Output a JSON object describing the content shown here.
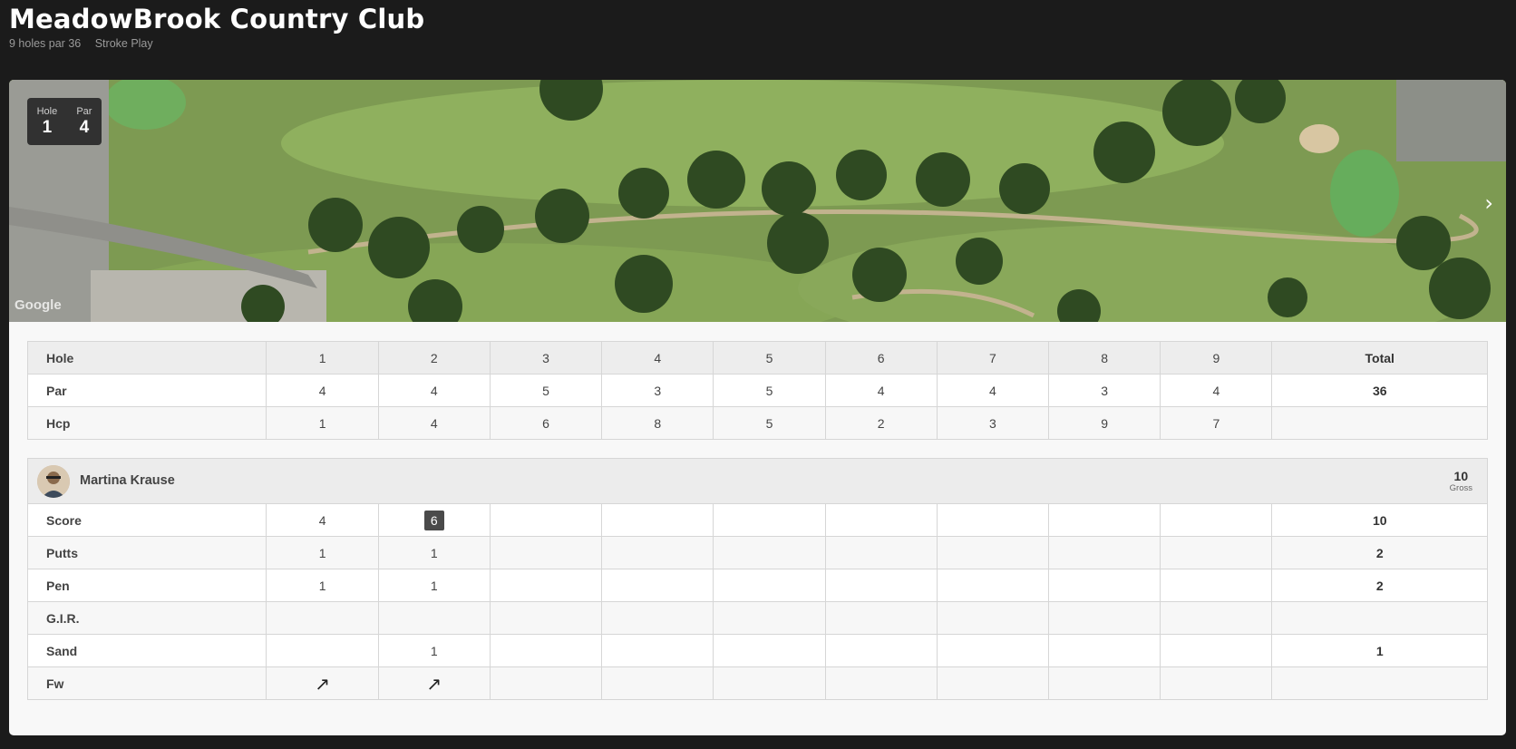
{
  "club": {
    "name": "MeadowBrook Country Club",
    "holes_info": "9 holes par 36",
    "format": "Stroke Play"
  },
  "hole_badge": {
    "hole_label": "Hole",
    "hole_value": "1",
    "par_label": "Par",
    "par_value": "4"
  },
  "map": {
    "attribution": "Google",
    "next_icon": "chevron-right-icon"
  },
  "course_table": {
    "headers": [
      "Hole",
      "1",
      "2",
      "3",
      "4",
      "5",
      "6",
      "7",
      "8",
      "9",
      "Total"
    ],
    "par": [
      "Par",
      "4",
      "4",
      "5",
      "3",
      "5",
      "4",
      "4",
      "3",
      "4",
      "36"
    ],
    "hcp": [
      "Hcp",
      "1",
      "4",
      "6",
      "8",
      "5",
      "2",
      "3",
      "9",
      "7",
      ""
    ]
  },
  "player": {
    "name": "Martina Krause",
    "gross_value": "10",
    "gross_label": "Gross"
  },
  "score_table": {
    "score": [
      "Score",
      "4",
      "6",
      "",
      "",
      "",
      "",
      "",
      "",
      "",
      "10"
    ],
    "putts": [
      "Putts",
      "1",
      "1",
      "",
      "",
      "",
      "",
      "",
      "",
      "",
      "2"
    ],
    "pen": [
      "Pen",
      "1",
      "1",
      "",
      "",
      "",
      "",
      "",
      "",
      "",
      "2"
    ],
    "gir": [
      "G.I.R.",
      "",
      "",
      "",
      "",
      "",
      "",
      "",
      "",
      "",
      ""
    ],
    "sand": [
      "Sand",
      "",
      "1",
      "",
      "",
      "",
      "",
      "",
      "",
      "",
      "1"
    ],
    "fw": [
      "Fw",
      "↗",
      "↗",
      "",
      "",
      "",
      "",
      "",
      "",
      "",
      ""
    ]
  },
  "colors": {
    "background": "#1b1b1b",
    "card": "#f8f8f8",
    "score_highlight": "#4a4a4a"
  }
}
